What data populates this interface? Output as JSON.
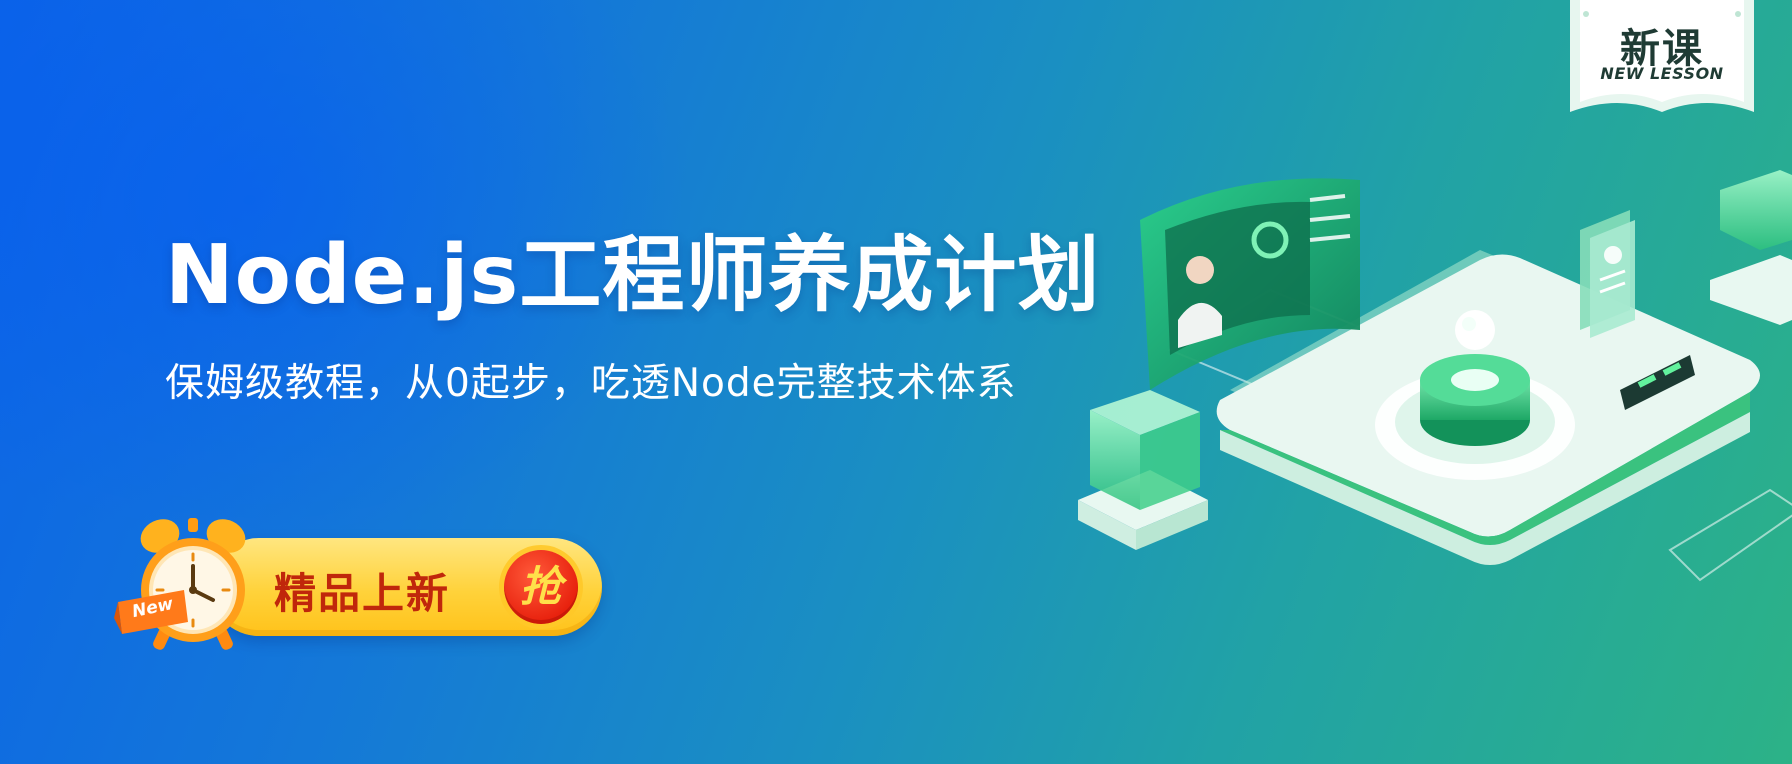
{
  "banner": {
    "title": "Node.js工程师养成计划",
    "subtitle": "保姆级教程，从0起步，吃透Node完整技术体系"
  },
  "cta": {
    "label": "精品上新",
    "action_glyph": "抢",
    "tag": "New"
  },
  "badge": {
    "title": "新课",
    "subtitle": "NEW LESSON"
  },
  "colors": {
    "gradient_start": "#0b63e8",
    "gradient_end": "#2cb287",
    "cta_yellow": "#ffd23a",
    "cta_text": "#c0270b",
    "cta_button": "#e8220e",
    "illustration_green": "#2ec27e"
  },
  "icons": [
    "alarm-clock-icon",
    "new-ribbon-icon",
    "badge-ribbon-icon"
  ]
}
